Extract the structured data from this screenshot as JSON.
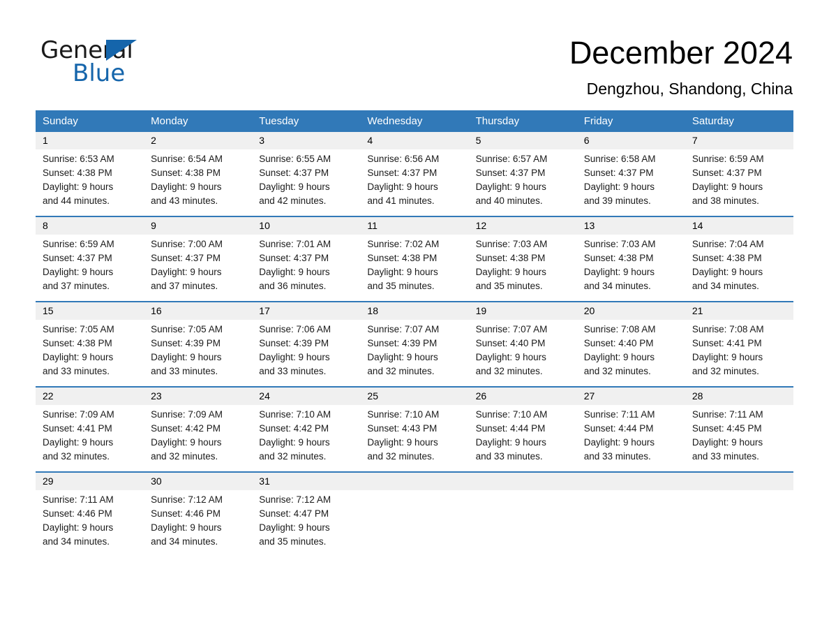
{
  "brand": {
    "name_part1": "General",
    "name_part2": "Blue",
    "accent_color": "#1565ab",
    "triangle_icon": "brand-triangle-icon"
  },
  "header": {
    "month_title": "December 2024",
    "location": "Dengzhou, Shandong, China"
  },
  "calendar": {
    "header_bg": "#3179b8",
    "daynumber_bg": "#f0f0f0",
    "weekdays": [
      "Sunday",
      "Monday",
      "Tuesday",
      "Wednesday",
      "Thursday",
      "Friday",
      "Saturday"
    ],
    "weeks": [
      {
        "days": [
          {
            "num": "1",
            "sunrise": "Sunrise: 6:53 AM",
            "sunset": "Sunset: 4:38 PM",
            "daylight1": "Daylight: 9 hours",
            "daylight2": "and 44 minutes."
          },
          {
            "num": "2",
            "sunrise": "Sunrise: 6:54 AM",
            "sunset": "Sunset: 4:38 PM",
            "daylight1": "Daylight: 9 hours",
            "daylight2": "and 43 minutes."
          },
          {
            "num": "3",
            "sunrise": "Sunrise: 6:55 AM",
            "sunset": "Sunset: 4:37 PM",
            "daylight1": "Daylight: 9 hours",
            "daylight2": "and 42 minutes."
          },
          {
            "num": "4",
            "sunrise": "Sunrise: 6:56 AM",
            "sunset": "Sunset: 4:37 PM",
            "daylight1": "Daylight: 9 hours",
            "daylight2": "and 41 minutes."
          },
          {
            "num": "5",
            "sunrise": "Sunrise: 6:57 AM",
            "sunset": "Sunset: 4:37 PM",
            "daylight1": "Daylight: 9 hours",
            "daylight2": "and 40 minutes."
          },
          {
            "num": "6",
            "sunrise": "Sunrise: 6:58 AM",
            "sunset": "Sunset: 4:37 PM",
            "daylight1": "Daylight: 9 hours",
            "daylight2": "and 39 minutes."
          },
          {
            "num": "7",
            "sunrise": "Sunrise: 6:59 AM",
            "sunset": "Sunset: 4:37 PM",
            "daylight1": "Daylight: 9 hours",
            "daylight2": "and 38 minutes."
          }
        ]
      },
      {
        "days": [
          {
            "num": "8",
            "sunrise": "Sunrise: 6:59 AM",
            "sunset": "Sunset: 4:37 PM",
            "daylight1": "Daylight: 9 hours",
            "daylight2": "and 37 minutes."
          },
          {
            "num": "9",
            "sunrise": "Sunrise: 7:00 AM",
            "sunset": "Sunset: 4:37 PM",
            "daylight1": "Daylight: 9 hours",
            "daylight2": "and 37 minutes."
          },
          {
            "num": "10",
            "sunrise": "Sunrise: 7:01 AM",
            "sunset": "Sunset: 4:37 PM",
            "daylight1": "Daylight: 9 hours",
            "daylight2": "and 36 minutes."
          },
          {
            "num": "11",
            "sunrise": "Sunrise: 7:02 AM",
            "sunset": "Sunset: 4:38 PM",
            "daylight1": "Daylight: 9 hours",
            "daylight2": "and 35 minutes."
          },
          {
            "num": "12",
            "sunrise": "Sunrise: 7:03 AM",
            "sunset": "Sunset: 4:38 PM",
            "daylight1": "Daylight: 9 hours",
            "daylight2": "and 35 minutes."
          },
          {
            "num": "13",
            "sunrise": "Sunrise: 7:03 AM",
            "sunset": "Sunset: 4:38 PM",
            "daylight1": "Daylight: 9 hours",
            "daylight2": "and 34 minutes."
          },
          {
            "num": "14",
            "sunrise": "Sunrise: 7:04 AM",
            "sunset": "Sunset: 4:38 PM",
            "daylight1": "Daylight: 9 hours",
            "daylight2": "and 34 minutes."
          }
        ]
      },
      {
        "days": [
          {
            "num": "15",
            "sunrise": "Sunrise: 7:05 AM",
            "sunset": "Sunset: 4:38 PM",
            "daylight1": "Daylight: 9 hours",
            "daylight2": "and 33 minutes."
          },
          {
            "num": "16",
            "sunrise": "Sunrise: 7:05 AM",
            "sunset": "Sunset: 4:39 PM",
            "daylight1": "Daylight: 9 hours",
            "daylight2": "and 33 minutes."
          },
          {
            "num": "17",
            "sunrise": "Sunrise: 7:06 AM",
            "sunset": "Sunset: 4:39 PM",
            "daylight1": "Daylight: 9 hours",
            "daylight2": "and 33 minutes."
          },
          {
            "num": "18",
            "sunrise": "Sunrise: 7:07 AM",
            "sunset": "Sunset: 4:39 PM",
            "daylight1": "Daylight: 9 hours",
            "daylight2": "and 32 minutes."
          },
          {
            "num": "19",
            "sunrise": "Sunrise: 7:07 AM",
            "sunset": "Sunset: 4:40 PM",
            "daylight1": "Daylight: 9 hours",
            "daylight2": "and 32 minutes."
          },
          {
            "num": "20",
            "sunrise": "Sunrise: 7:08 AM",
            "sunset": "Sunset: 4:40 PM",
            "daylight1": "Daylight: 9 hours",
            "daylight2": "and 32 minutes."
          },
          {
            "num": "21",
            "sunrise": "Sunrise: 7:08 AM",
            "sunset": "Sunset: 4:41 PM",
            "daylight1": "Daylight: 9 hours",
            "daylight2": "and 32 minutes."
          }
        ]
      },
      {
        "days": [
          {
            "num": "22",
            "sunrise": "Sunrise: 7:09 AM",
            "sunset": "Sunset: 4:41 PM",
            "daylight1": "Daylight: 9 hours",
            "daylight2": "and 32 minutes."
          },
          {
            "num": "23",
            "sunrise": "Sunrise: 7:09 AM",
            "sunset": "Sunset: 4:42 PM",
            "daylight1": "Daylight: 9 hours",
            "daylight2": "and 32 minutes."
          },
          {
            "num": "24",
            "sunrise": "Sunrise: 7:10 AM",
            "sunset": "Sunset: 4:42 PM",
            "daylight1": "Daylight: 9 hours",
            "daylight2": "and 32 minutes."
          },
          {
            "num": "25",
            "sunrise": "Sunrise: 7:10 AM",
            "sunset": "Sunset: 4:43 PM",
            "daylight1": "Daylight: 9 hours",
            "daylight2": "and 32 minutes."
          },
          {
            "num": "26",
            "sunrise": "Sunrise: 7:10 AM",
            "sunset": "Sunset: 4:44 PM",
            "daylight1": "Daylight: 9 hours",
            "daylight2": "and 33 minutes."
          },
          {
            "num": "27",
            "sunrise": "Sunrise: 7:11 AM",
            "sunset": "Sunset: 4:44 PM",
            "daylight1": "Daylight: 9 hours",
            "daylight2": "and 33 minutes."
          },
          {
            "num": "28",
            "sunrise": "Sunrise: 7:11 AM",
            "sunset": "Sunset: 4:45 PM",
            "daylight1": "Daylight: 9 hours",
            "daylight2": "and 33 minutes."
          }
        ]
      },
      {
        "days": [
          {
            "num": "29",
            "sunrise": "Sunrise: 7:11 AM",
            "sunset": "Sunset: 4:46 PM",
            "daylight1": "Daylight: 9 hours",
            "daylight2": "and 34 minutes."
          },
          {
            "num": "30",
            "sunrise": "Sunrise: 7:12 AM",
            "sunset": "Sunset: 4:46 PM",
            "daylight1": "Daylight: 9 hours",
            "daylight2": "and 34 minutes."
          },
          {
            "num": "31",
            "sunrise": "Sunrise: 7:12 AM",
            "sunset": "Sunset: 4:47 PM",
            "daylight1": "Daylight: 9 hours",
            "daylight2": "and 35 minutes."
          },
          {
            "num": "",
            "sunrise": "",
            "sunset": "",
            "daylight1": "",
            "daylight2": ""
          },
          {
            "num": "",
            "sunrise": "",
            "sunset": "",
            "daylight1": "",
            "daylight2": ""
          },
          {
            "num": "",
            "sunrise": "",
            "sunset": "",
            "daylight1": "",
            "daylight2": ""
          },
          {
            "num": "",
            "sunrise": "",
            "sunset": "",
            "daylight1": "",
            "daylight2": ""
          }
        ]
      }
    ]
  }
}
